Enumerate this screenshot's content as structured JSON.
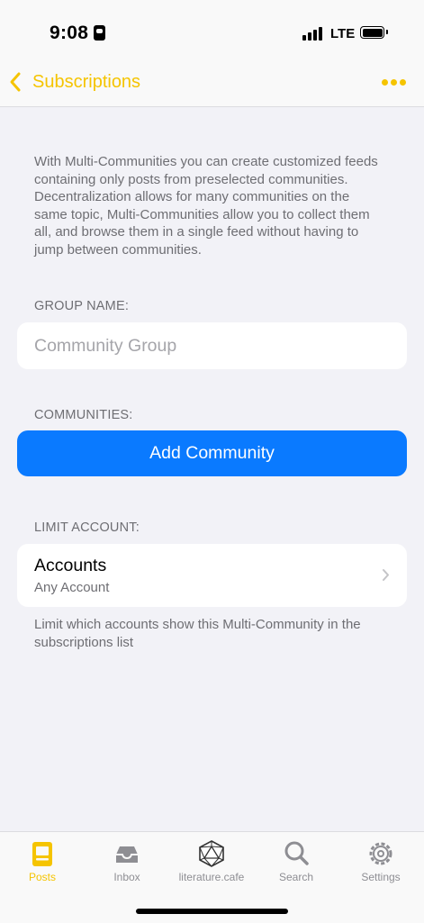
{
  "status_bar": {
    "time": "9:08",
    "network": "LTE"
  },
  "nav": {
    "back_label": "Subscriptions",
    "more_icon": "ellipsis-icon"
  },
  "description": "With Multi-Communities you can create customized feeds containing only posts from preselected communities. Decentralization allows for many communities on the same topic, Multi-Communities allow you to collect them all, and browse them in a single feed without having to jump between communities.",
  "group_name": {
    "label": "GROUP NAME:",
    "placeholder": "Community Group",
    "value": ""
  },
  "communities": {
    "label": "COMMUNITIES:",
    "add_button": "Add Community"
  },
  "limit_account": {
    "label": "LIMIT ACCOUNT:",
    "title": "Accounts",
    "value": "Any Account",
    "note": "Limit which accounts show this Multi-Community in the subscriptions list"
  },
  "tabs": [
    {
      "label": "Posts",
      "icon": "posts-icon",
      "active": true
    },
    {
      "label": "Inbox",
      "icon": "inbox-icon",
      "active": false
    },
    {
      "label": "literature.cafe",
      "icon": "d20-icon",
      "active": false
    },
    {
      "label": "Search",
      "icon": "search-icon",
      "active": false
    },
    {
      "label": "Settings",
      "icon": "gear-icon",
      "active": false
    }
  ],
  "colors": {
    "accent": "#f5c400",
    "button": "#0a7aff",
    "background": "#f2f2f7"
  }
}
